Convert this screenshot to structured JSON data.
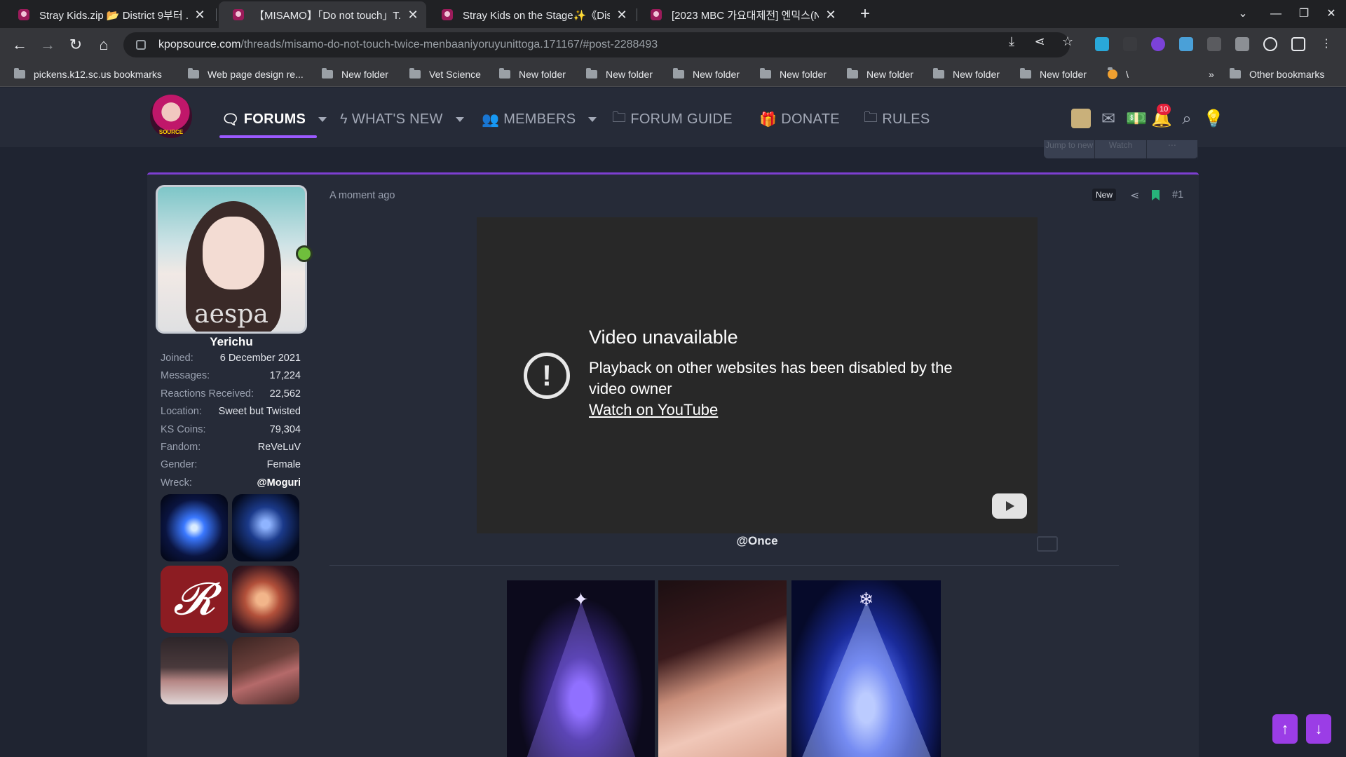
{
  "browser": {
    "tabs": [
      {
        "title": "Stray Kids.zip 📂 District 9부터 ...",
        "active": false
      },
      {
        "title": "【MISAMO】「Do not touch」T...",
        "active": true
      },
      {
        "title": "Stray Kids on the Stage✨《Dist...",
        "active": false
      },
      {
        "title": "[2023 MBC 가요대제전] 엔믹스(NM...",
        "active": false
      }
    ],
    "url_host": "kpopsource.com",
    "url_path": "/threads/misamo-do-not-touch-twice-menbaaniyoruyunittoga.171167/#post-2288493",
    "bookmarks": [
      "pickens.k12.sc.us bookmarks",
      "Web page design re...",
      "New folder",
      "Vet Science",
      "New folder",
      "New folder",
      "New folder",
      "New folder",
      "New folder",
      "New folder",
      "New folder",
      "\\"
    ],
    "other_bookmarks": "Other bookmarks",
    "more_chevron": "»"
  },
  "site": {
    "nav": [
      {
        "label": "FORUMS",
        "icon": "chat-icon",
        "caret": true,
        "active": true
      },
      {
        "label": "WHAT'S NEW",
        "icon": "bolt-icon",
        "caret": true,
        "active": false
      },
      {
        "label": "MEMBERS",
        "icon": "users-icon",
        "caret": true,
        "active": false
      },
      {
        "label": "FORUM GUIDE",
        "icon": "folder-icon",
        "caret": false,
        "active": false
      },
      {
        "label": "DONATE",
        "icon": "gift-icon",
        "caret": false,
        "active": false
      },
      {
        "label": "RULES",
        "icon": "folder-icon",
        "caret": false,
        "active": false
      }
    ],
    "logo_text": "SOURCE",
    "alerts_count": "10",
    "thread_buttons": [
      "Jump to new",
      "Watch",
      "⋯"
    ]
  },
  "post": {
    "user": {
      "name": "Yerichu",
      "avatar_watermark": "aespa",
      "stats": [
        {
          "k": "Joined:",
          "v": "6 December 2021"
        },
        {
          "k": "Messages:",
          "v": "17,224"
        },
        {
          "k": "Reactions Received:",
          "v": "22,562"
        },
        {
          "k": "Location:",
          "v": "Sweet but Twisted"
        },
        {
          "k": "KS Coins:",
          "v": "79,304"
        },
        {
          "k": "Fandom:",
          "v": "ReVeLuV"
        },
        {
          "k": "Gender:",
          "v": "Female"
        },
        {
          "k": "Wreck:",
          "v": "@Moguri"
        }
      ]
    },
    "timestamp": "A moment ago",
    "new_tag": "New",
    "number": "#1",
    "video": {
      "title": "Video unavailable",
      "message": "Playback on other websites has been disabled by the video owner",
      "link": "Watch on YouTube"
    },
    "mention": "@Once"
  },
  "colors": {
    "accent": "#9b59ff",
    "post_border": "#7d3fd1",
    "scroll_button": "#9b3de6",
    "alert_badge": "#e5203a",
    "bookmark": "#27b37a"
  }
}
